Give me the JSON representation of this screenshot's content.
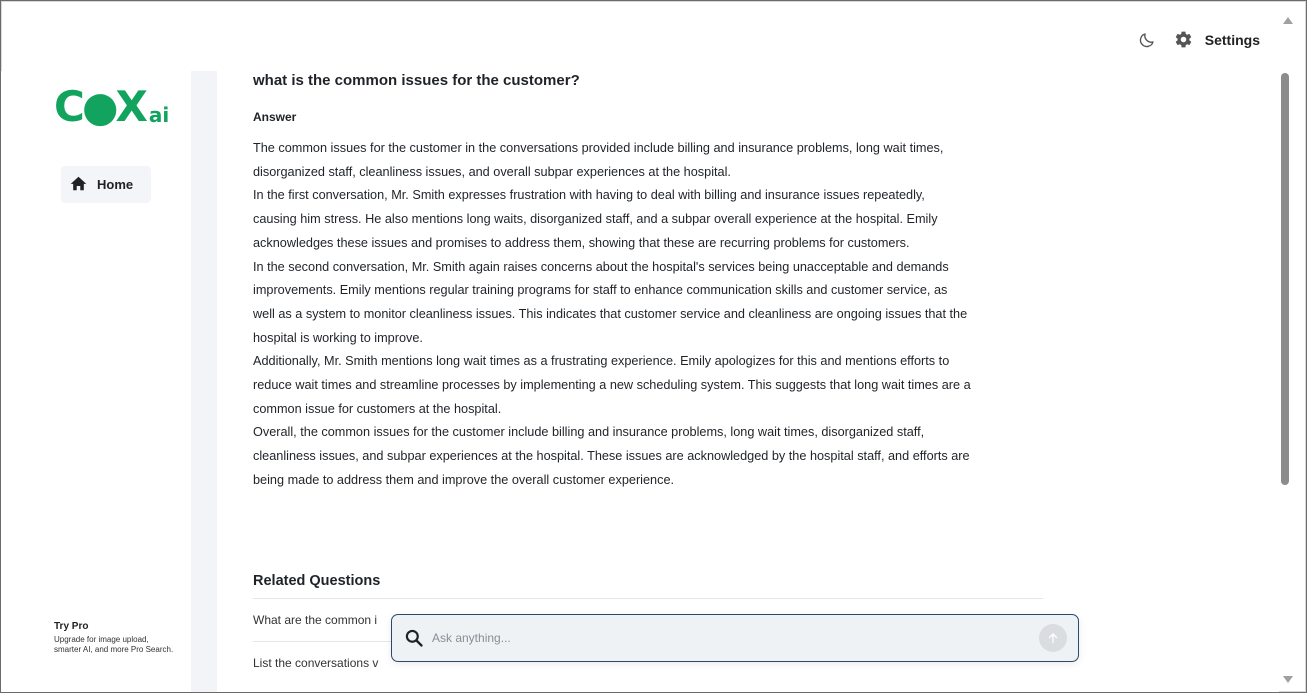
{
  "header": {
    "settings_label": "Settings",
    "theme_icon": "moon-icon",
    "settings_icon": "gear-icon"
  },
  "sidebar": {
    "logo_main": "C●X",
    "logo_ai": "ai",
    "nav": [
      {
        "label": "Home",
        "icon": "home-icon"
      }
    ],
    "try_pro": {
      "title": "Try Pro",
      "description": "Upgrade for image upload, smarter AI, and more Pro Search."
    }
  },
  "main": {
    "question": "what is the common issues for the customer?",
    "answer_label": "Answer",
    "answer_lines": [
      "The common issues for the customer in the conversations provided include billing and insurance problems, long wait times,",
      "disorganized staff, cleanliness issues, and overall subpar experiences at the hospital.",
      "In the first conversation, Mr. Smith expresses frustration with having to deal with billing and insurance issues repeatedly,",
      "causing him stress. He also mentions long waits, disorganized staff, and a subpar overall experience at the hospital. Emily",
      "acknowledges these issues and promises to address them, showing that these are recurring problems for customers.",
      "In the second conversation, Mr. Smith again raises concerns about the hospital's services being unacceptable and demands",
      "improvements. Emily mentions regular training programs for staff to enhance communication skills and customer service, as",
      "well as a system to monitor cleanliness issues. This indicates that customer service and cleanliness are ongoing issues that the",
      "hospital is working to improve.",
      "Additionally, Mr. Smith mentions long wait times as a frustrating experience. Emily apologizes for this and mentions efforts to",
      "reduce wait times and streamline processes by implementing a new scheduling system. This suggests that long wait times are a",
      "common issue for customers at the hospital.",
      "Overall, the common issues for the customer include billing and insurance problems, long wait times, disorganized staff,",
      "cleanliness issues, and subpar experiences at the hospital. These issues are acknowledged by the hospital staff, and efforts are",
      "being made to address them and improve the overall customer experience."
    ],
    "related_title": "Related Questions",
    "related_questions": [
      "What are the common i",
      "List the conversations v"
    ]
  },
  "search": {
    "placeholder": "Ask anything...",
    "value": ""
  }
}
